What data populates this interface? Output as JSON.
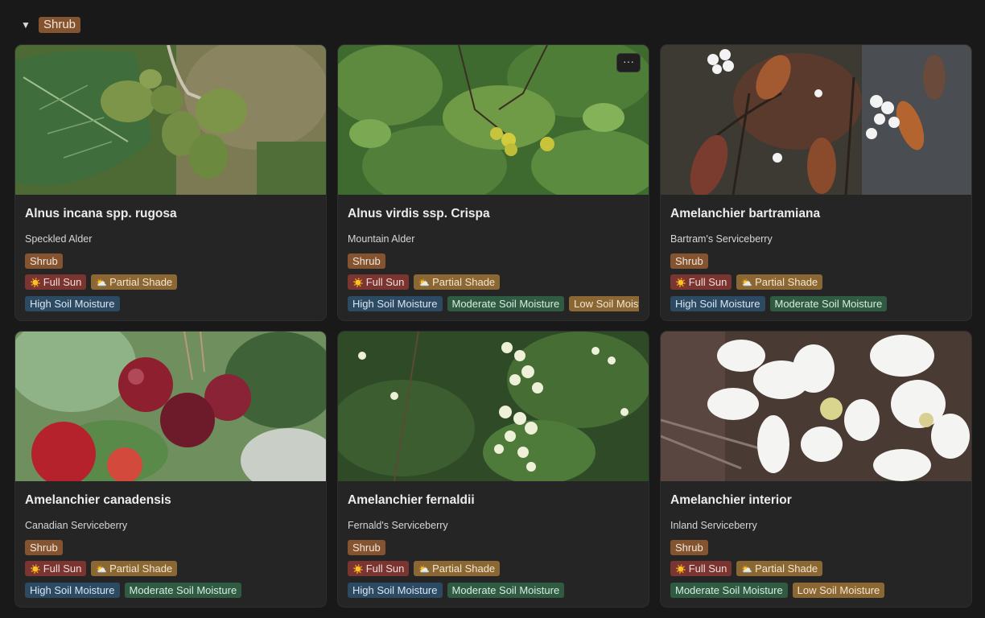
{
  "group": {
    "toggle": "▼",
    "label": "Shrub"
  },
  "more_label": "···",
  "sun_icon": "☀️",
  "shade_icon": "⛅",
  "cards": [
    {
      "title": "Alnus incana spp. rugosa",
      "common": "Speckled Alder",
      "category": "Shrub",
      "sun": "Full Sun",
      "shade": "Partial Shade",
      "moisture": [
        {
          "label": "High Soil Moisture",
          "kind": "high"
        }
      ]
    },
    {
      "title": "Alnus virdis ssp. Crispa",
      "common": "Mountain Alder",
      "category": "Shrub",
      "sun": "Full Sun",
      "shade": "Partial Shade",
      "moisture": [
        {
          "label": "High Soil Moisture",
          "kind": "high"
        },
        {
          "label": "Moderate Soil Moisture",
          "kind": "moderate"
        },
        {
          "label": "Low Soil Moisture",
          "kind": "low"
        }
      ]
    },
    {
      "title": "Amelanchier bartramiana",
      "common": "Bartram's Serviceberry",
      "category": "Shrub",
      "sun": "Full Sun",
      "shade": "Partial Shade",
      "moisture": [
        {
          "label": "High Soil Moisture",
          "kind": "high"
        },
        {
          "label": "Moderate Soil Moisture",
          "kind": "moderate"
        }
      ]
    },
    {
      "title": "Amelanchier canadensis",
      "common": "Canadian Serviceberry",
      "category": "Shrub",
      "sun": "Full Sun",
      "shade": "Partial Shade",
      "moisture": [
        {
          "label": "High Soil Moisture",
          "kind": "high"
        },
        {
          "label": "Moderate Soil Moisture",
          "kind": "moderate"
        }
      ]
    },
    {
      "title": "Amelanchier fernaldii",
      "common": "Fernald's Serviceberry",
      "category": "Shrub",
      "sun": "Full Sun",
      "shade": "Partial Shade",
      "moisture": [
        {
          "label": "High Soil Moisture",
          "kind": "high"
        },
        {
          "label": "Moderate Soil Moisture",
          "kind": "moderate"
        }
      ]
    },
    {
      "title": "Amelanchier interior",
      "common": "Inland Serviceberry",
      "category": "Shrub",
      "sun": "Full Sun",
      "shade": "Partial Shade",
      "moisture": [
        {
          "label": "Moderate Soil Moisture",
          "kind": "moderate"
        },
        {
          "label": "Low Soil Moisture",
          "kind": "low"
        }
      ]
    }
  ],
  "colors": {
    "background": "#191919",
    "card": "#252525",
    "shrub_tag": "#845430",
    "sun_tag": "#7a3530",
    "shade_tag": "#8b6733",
    "high_tag": "#2c4a62",
    "moderate_tag": "#2e5b42",
    "low_tag": "#8b6733"
  }
}
